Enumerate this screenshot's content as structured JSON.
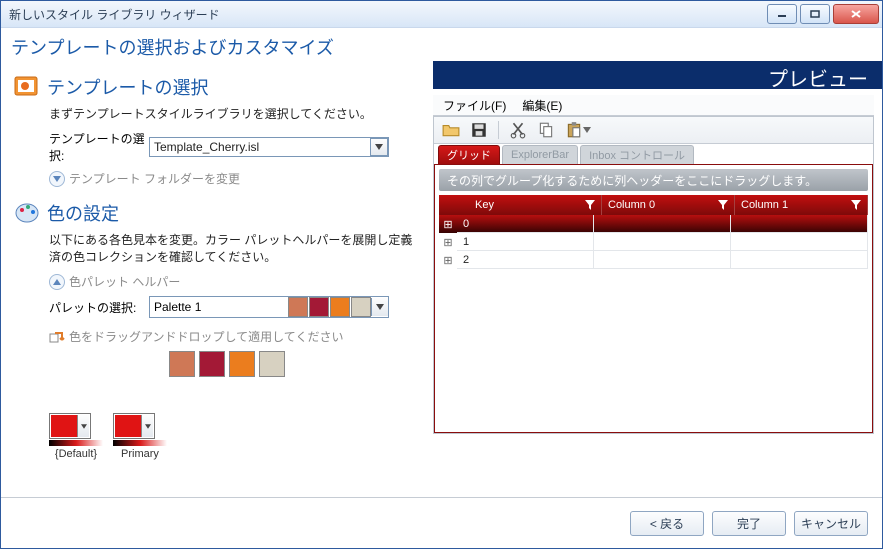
{
  "window": {
    "title": "新しいスタイル ライブラリ ウィザード"
  },
  "subtitle": "テンプレートの選択およびカスタマイズ",
  "template_section": {
    "title": "テンプレートの選択",
    "desc": "まずテンプレートスタイルライブラリを選択してください。",
    "label": "テンプレートの選択:",
    "value": "Template_Cherry.isl",
    "folder_link": "テンプレート フォルダーを変更"
  },
  "color_section": {
    "title": "色の設定",
    "desc": "以下にある各色見本を変更。カラー パレットヘルパーを展開し定義済の色コレクションを確認してください。",
    "helper_link": "色パレット ヘルパー",
    "palette_label": "パレットの選択:",
    "palette_value": "Palette 1",
    "palette_swatches": [
      "#cf7856",
      "#a31936",
      "#eb7d1e",
      "#d7d1c1"
    ],
    "drag_hint": "色をドラッグアンドドロップして適用してください",
    "big_swatches": [
      "#cf7856",
      "#a31936",
      "#eb7d1e",
      "#d7d1c1"
    ],
    "tones": [
      {
        "name": "{Default}",
        "color": "#e01414"
      },
      {
        "name": "Primary",
        "color": "#e01414"
      }
    ]
  },
  "preview": {
    "title": "プレビュー",
    "menu": {
      "file": "ファイル(F)",
      "edit": "編集(E)"
    },
    "tabs": [
      {
        "label": "グリッド",
        "active": true
      },
      {
        "label": "ExplorerBar",
        "active": false
      },
      {
        "label": "Inbox コントロール",
        "active": false
      }
    ],
    "group_hint": "その列でグループ化するために列ヘッダーをここにドラッグします。",
    "columns": [
      "Key",
      "Column 0",
      "Column 1"
    ],
    "rows": [
      {
        "key": "0",
        "c0": "",
        "c1": "",
        "selected": true
      },
      {
        "key": "1",
        "c0": "",
        "c1": "",
        "selected": false
      },
      {
        "key": "2",
        "c0": "",
        "c1": "",
        "selected": false
      }
    ]
  },
  "footer": {
    "back": "< 戻る",
    "finish": "完了",
    "cancel": "キャンセル"
  }
}
